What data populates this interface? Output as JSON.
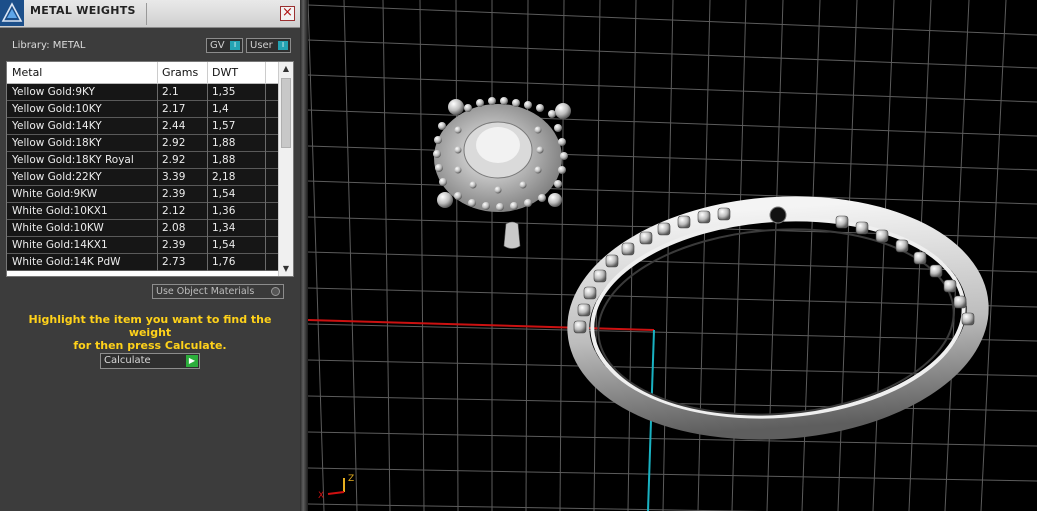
{
  "window": {
    "title": "METAL WEIGHTS",
    "close_glyph": "×"
  },
  "library": {
    "label": "Library: METAL",
    "toggles": [
      {
        "label": "GV",
        "indicator": "I"
      },
      {
        "label": "User",
        "indicator": "I"
      }
    ]
  },
  "table": {
    "columns": [
      "Metal",
      "Grams",
      "DWT"
    ],
    "rows": [
      {
        "metal": "Yellow Gold:9KY",
        "grams": "2.1",
        "dwt": "1,35"
      },
      {
        "metal": "Yellow Gold:10KY",
        "grams": "2.17",
        "dwt": "1,4"
      },
      {
        "metal": "Yellow Gold:14KY",
        "grams": "2.44",
        "dwt": "1,57"
      },
      {
        "metal": "Yellow Gold:18KY",
        "grams": "2.92",
        "dwt": "1,88"
      },
      {
        "metal": "Yellow Gold:18KY Royal",
        "grams": "2.92",
        "dwt": "1,88"
      },
      {
        "metal": "Yellow Gold:22KY",
        "grams": "3.39",
        "dwt": "2,18"
      },
      {
        "metal": "White Gold:9KW",
        "grams": "2.39",
        "dwt": "1,54"
      },
      {
        "metal": "White Gold:10KX1",
        "grams": "2.12",
        "dwt": "1,36"
      },
      {
        "metal": "White Gold:10KW",
        "grams": "2.08",
        "dwt": "1,34"
      },
      {
        "metal": "White Gold:14KX1",
        "grams": "2.39",
        "dwt": "1,54"
      },
      {
        "metal": "White Gold:14K PdW",
        "grams": "2.73",
        "dwt": "1,76"
      }
    ],
    "scroll_up_glyph": "▲",
    "scroll_down_glyph": "▼"
  },
  "use_object_materials": {
    "label": "Use Object Materials"
  },
  "instructions": {
    "line1": "Highlight the item you want to find the weight",
    "line2": "for then press Calculate."
  },
  "calculate": {
    "label": "Calculate",
    "go_glyph": "▶"
  },
  "viewport": {
    "axis_label_z": "Z",
    "axis_label_x": "X",
    "colors": {
      "grid": "#5a5a5a",
      "x_axis": "#d01010",
      "y_axis": "#18b4c4",
      "z_axis": "#e8b020",
      "metal": "#d8d8d8"
    }
  },
  "icons": {
    "app_logo": "triangle-logo-icon",
    "close": "close-icon",
    "toggle_indicator": "toggle-indicator-icon",
    "radio": "radio-icon",
    "go": "play-arrow-icon"
  }
}
